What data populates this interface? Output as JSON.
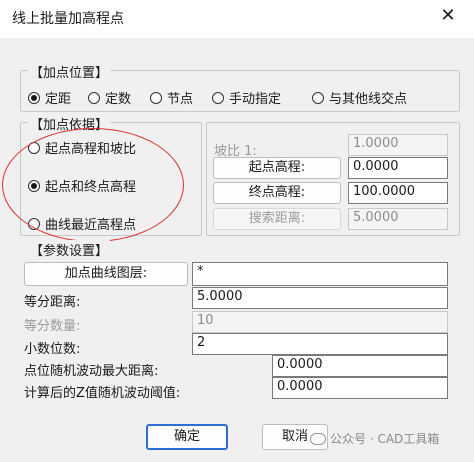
{
  "window": {
    "title": "线上批量加高程点",
    "close_glyph": "✕"
  },
  "position_group": {
    "legend": "【加点位置】",
    "options": [
      {
        "label": "定距",
        "checked": true
      },
      {
        "label": "定数",
        "checked": false
      },
      {
        "label": "节点",
        "checked": false
      },
      {
        "label": "手动指定",
        "checked": false
      },
      {
        "label": "与其他线交点",
        "checked": false
      }
    ]
  },
  "basis_group": {
    "legend": "【加点依据】",
    "options": [
      {
        "label": "起点高程和坡比",
        "checked": false
      },
      {
        "label": "起点和终点高程",
        "checked": true
      },
      {
        "label": "曲线最近高程点",
        "checked": false
      }
    ],
    "slope_label": "坡比 1:",
    "slope_value": "1.0000",
    "start_elev_button": "起点高程:",
    "start_elev_value": "0.0000",
    "end_elev_button": "终点高程:",
    "end_elev_value": "100.0000",
    "search_dist_button": "搜索距离:",
    "search_dist_value": "5.0000"
  },
  "params_group": {
    "legend": "【参数设置】",
    "layer_button": "加点曲线图层:",
    "layer_value": "*",
    "equal_dist_label": "等分距离:",
    "equal_dist_value": "5.0000",
    "equal_count_label": "等分数量:",
    "equal_count_value": "10",
    "decimals_label": "小数位数:",
    "decimals_value": "2",
    "max_random_label": "点位随机波动最大距离:",
    "max_random_value": "0.0000",
    "z_random_label": "计算后的Z值随机波动阈值:",
    "z_random_value": "0.0000"
  },
  "footer": {
    "ok": "确定",
    "cancel": "取消"
  },
  "watermark": {
    "text": "公众号 · CAD工具箱"
  },
  "colors": {
    "annotation_ellipse": "#e03030",
    "primary_border": "#2a6fd6"
  }
}
